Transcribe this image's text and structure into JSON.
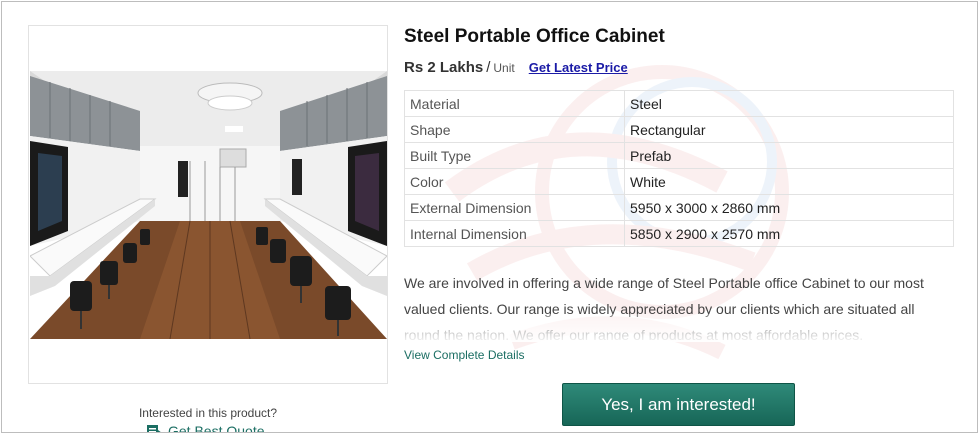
{
  "product": {
    "title": "Steel Portable Office Cabinet",
    "price": "Rs 2 Lakhs",
    "price_separator": "/",
    "unit": "Unit",
    "latest_price_link": "Get Latest Price"
  },
  "specs": [
    {
      "key": "Material",
      "value": "Steel"
    },
    {
      "key": "Shape",
      "value": "Rectangular"
    },
    {
      "key": "Built Type",
      "value": "Prefab"
    },
    {
      "key": "Color",
      "value": "White"
    },
    {
      "key": "External Dimension",
      "value": "5950 x 3000 x 2860 mm"
    },
    {
      "key": "Internal Dimension",
      "value": "5850 x 2900 x 2570 mm"
    }
  ],
  "description": "We are involved in offering a wide range of Steel Portable office Cabinet to our most valued clients. Our range is widely appreciated by our clients which are situated all round the nation. We offer our range of products at most affordable prices.",
  "view_details": "View Complete Details",
  "interest_button": "Yes, I am interested!",
  "left_panel": {
    "interest_prompt": "Interested in this product?",
    "best_quote": "Get Best Quote",
    "quote_icon": "document-icon"
  },
  "colors": {
    "accent_green": "#1b6e63",
    "button_green": "#23796a",
    "link_blue": "#1a1aa6"
  }
}
